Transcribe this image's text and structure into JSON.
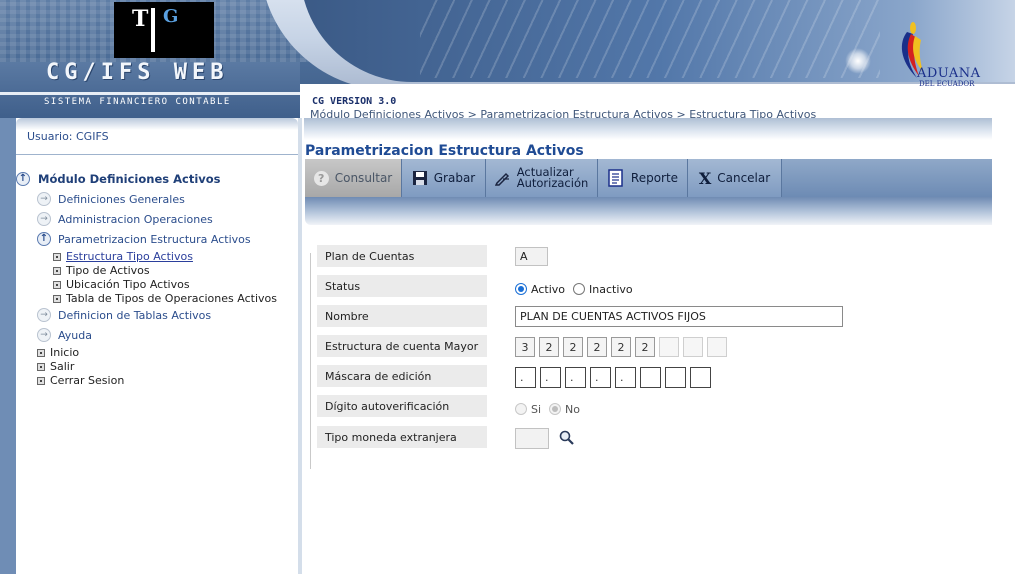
{
  "header": {
    "logo_left": {
      "t": "T",
      "g": "G"
    },
    "app_title": "CG/IFS WEB",
    "app_subtitle": "SISTEMA FINANCIERO CONTABLE",
    "version": "CG VERSION 3.0",
    "breadcrumb": "Módulo Definiciones Activos > Parametrizacion Estructura Activos > Estructura Tipo Activos",
    "logo_right": {
      "brand": "ADUANA",
      "sub": "DEL ECUADOR"
    }
  },
  "sidebar": {
    "user": "Usuario: CGIFS",
    "root": {
      "label": "Módulo Definiciones Activos",
      "icon": "circle-up-icon"
    },
    "items": [
      {
        "label": "Definiciones Generales",
        "icon": "circle-right-icon"
      },
      {
        "label": "Administracion Operaciones",
        "icon": "circle-right-icon"
      },
      {
        "label": "Parametrizacion Estructura Activos",
        "icon": "circle-up-icon"
      },
      {
        "label": "Definicion de Tablas Activos",
        "icon": "circle-right-icon"
      },
      {
        "label": "Ayuda",
        "icon": "circle-right-icon"
      }
    ],
    "sub_items": [
      {
        "label": "Estructura Tipo Activos",
        "active": true
      },
      {
        "label": "Tipo de Activos",
        "active": false
      },
      {
        "label": "Ubicación Tipo Activos",
        "active": false
      },
      {
        "label": "Tabla de Tipos de Operaciones Activos",
        "active": false
      }
    ],
    "plain_items": [
      "Inicio",
      "Salir",
      "Cerrar Sesion"
    ]
  },
  "main": {
    "page_title": "Parametrizacion Estructura Activos",
    "toolbar": {
      "consultar": "Consultar",
      "grabar": "Grabar",
      "actualizar_1": "Actualizar",
      "actualizar_2": "Autorización",
      "reporte": "Reporte",
      "cancelar": "Cancelar"
    },
    "form": {
      "plan_label": "Plan de Cuentas",
      "plan_value": "A",
      "status_label": "Status",
      "status_options": [
        "Activo",
        "Inactivo"
      ],
      "status_selected": "Activo",
      "nombre_label": "Nombre",
      "nombre_value": "PLAN DE CUENTAS ACTIVOS FIJOS",
      "estructura_label": "Estructura de cuenta Mayor",
      "estructura_values": [
        "3",
        "2",
        "2",
        "2",
        "2",
        "2",
        "",
        "",
        ""
      ],
      "mascara_label": "Máscara de edición",
      "mascara_values": [
        ".",
        ".",
        ".",
        ".",
        ".",
        "",
        "",
        ""
      ],
      "digito_label": "Dígito autoverificación",
      "digito_options": [
        "Si",
        "No"
      ],
      "digito_selected": "No",
      "moneda_label": "Tipo moneda extranjera",
      "moneda_value": ""
    }
  },
  "colors": {
    "header_blue": "#4a6b96",
    "title_blue": "#1f4b94",
    "link_blue": "#2b4d8c",
    "radio_blue": "#1a6fd6"
  }
}
